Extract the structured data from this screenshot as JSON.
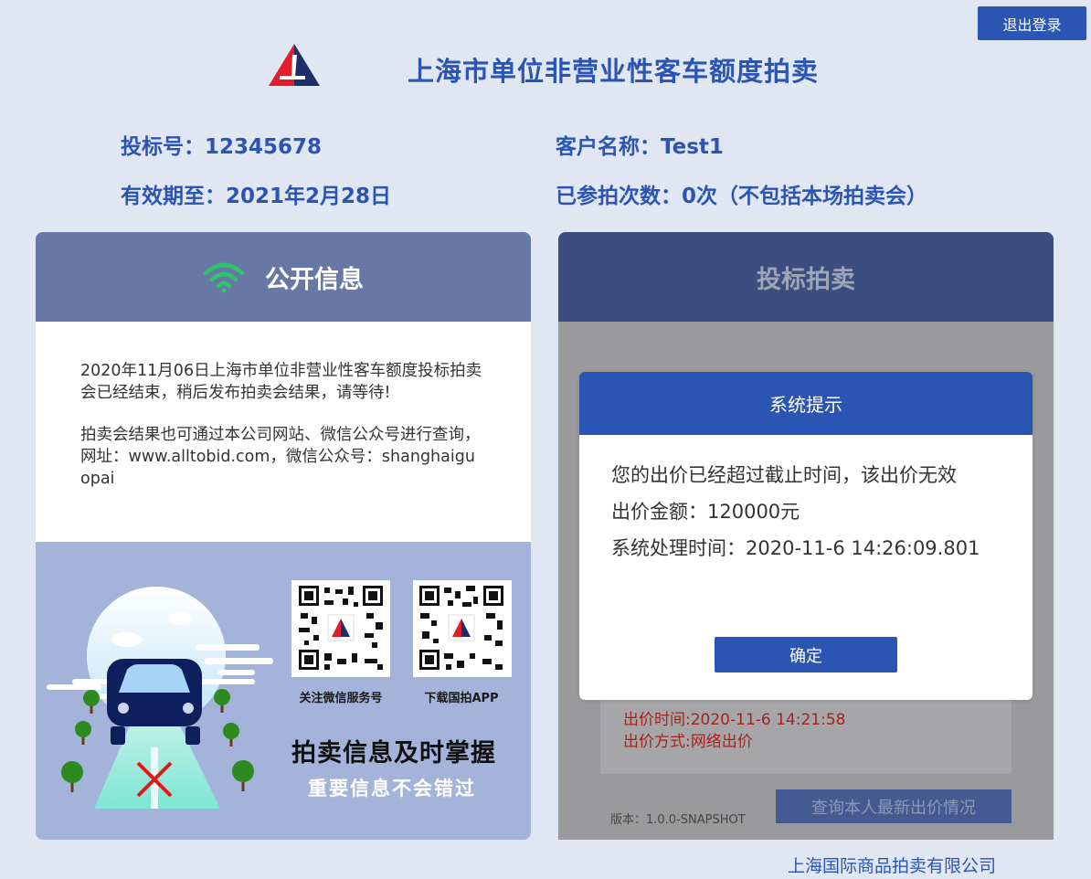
{
  "header": {
    "logout_label": "退出登录",
    "title": "上海市单位非营业性客车额度拍卖",
    "bid_no": "投标号：12345678",
    "customer": "客户名称：Test1",
    "valid_until": "有效期至：2021年2月28日",
    "times_participated": "已参拍次数：0次（不包括本场拍卖会）"
  },
  "left_panel": {
    "title": "公开信息",
    "paragraph1": "2020年11月06日上海市单位非营业性客车额度投标拍卖会已经结束，稍后发布拍卖会结果，请等待!",
    "paragraph2": "拍卖会结果也可通过本公司网站、微信公众号进行查询，网址：www.alltobid.com，微信公众号：shanghaiguopai",
    "qr1_caption": "关注微信服务号",
    "qr2_caption": "下载国拍APP",
    "slogan1": "拍卖信息及时掌握",
    "slogan2": "重要信息不会错过"
  },
  "right_panel": {
    "title": "投标拍卖",
    "bid_time": "出价时间:2020-11-6 14:21:58",
    "bid_method": "出价方式:网络出价",
    "version": "版本：1.0.0-SNAPSHOT",
    "query_button": "查询本人最新出价情况"
  },
  "modal": {
    "title": "系统提示",
    "line1": "您的出价已经超过截止时间，该出价无效",
    "line2": "出价金额：120000元",
    "line3": "系统处理时间：2020-11-6 14:26:09.801",
    "confirm_label": "确定"
  },
  "footer": {
    "company": "上海国际商品拍卖有限公司"
  },
  "colors": {
    "brand_blue": "#2b55b3",
    "bid_text_red": "#a5241d",
    "wifi_green": "#2ec46b"
  }
}
